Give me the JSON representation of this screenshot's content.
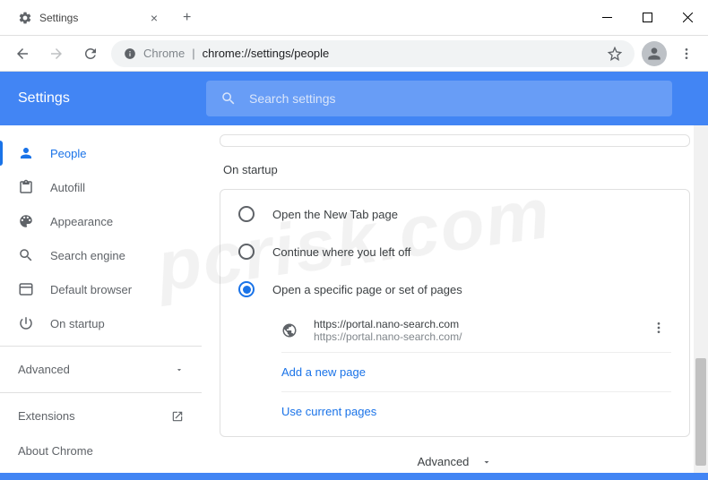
{
  "window": {
    "tab_title": "Settings"
  },
  "address": {
    "prefix": "Chrome",
    "url": "chrome://settings/people"
  },
  "header": {
    "title": "Settings",
    "search_placeholder": "Search settings"
  },
  "sidebar": {
    "items": [
      {
        "label": "People"
      },
      {
        "label": "Autofill"
      },
      {
        "label": "Appearance"
      },
      {
        "label": "Search engine"
      },
      {
        "label": "Default browser"
      },
      {
        "label": "On startup"
      }
    ],
    "advanced": "Advanced",
    "extensions": "Extensions",
    "about": "About Chrome"
  },
  "content": {
    "section_title": "On startup",
    "radios": [
      {
        "label": "Open the New Tab page"
      },
      {
        "label": "Continue where you left off"
      },
      {
        "label": "Open a specific page or set of pages"
      }
    ],
    "page": {
      "title": "https://portal.nano-search.com",
      "url": "https://portal.nano-search.com/"
    },
    "add_page": "Add a new page",
    "use_current": "Use current pages",
    "advanced_footer": "Advanced"
  },
  "watermark": "pcrisk.com"
}
